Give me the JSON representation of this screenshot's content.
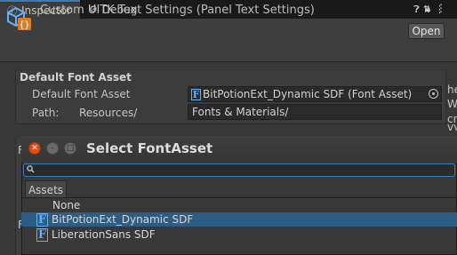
{
  "tabs": [
    {
      "label": "Inspector",
      "icon": "info-icon",
      "active": true
    },
    {
      "label": "Debug",
      "icon": "bug-icon",
      "active": false
    }
  ],
  "header": {
    "title": "Custom UITK Text Settings (Panel Text Settings)",
    "open_label": "Open"
  },
  "default_font_section": {
    "title": "Default Font Asset",
    "font_asset_label": "Default Font Asset",
    "font_asset_value": "BitPotionExt_Dynamic SDF (Font Asset)",
    "path_label": "Path:",
    "path_prefix": "Resources/",
    "path_value": "Fonts & Materials/"
  },
  "background_fragments": [
    "F",
    "F",
    "he",
    "W",
    "cr",
    "vv"
  ],
  "popup": {
    "title": "Select FontAsset",
    "search_value": "",
    "tab_assets": "Assets",
    "items": [
      {
        "label": "None",
        "selected": false,
        "has_icon": false
      },
      {
        "label": "BitPotionExt_Dynamic SDF",
        "selected": true,
        "has_icon": true
      },
      {
        "label": "LiberationSans SDF",
        "selected": false,
        "has_icon": true
      }
    ]
  },
  "colors": {
    "accent": "#3a79bb",
    "selection": "#2c5d87",
    "font_icon": "#5fb0ff",
    "close_button": "#df4a16"
  }
}
